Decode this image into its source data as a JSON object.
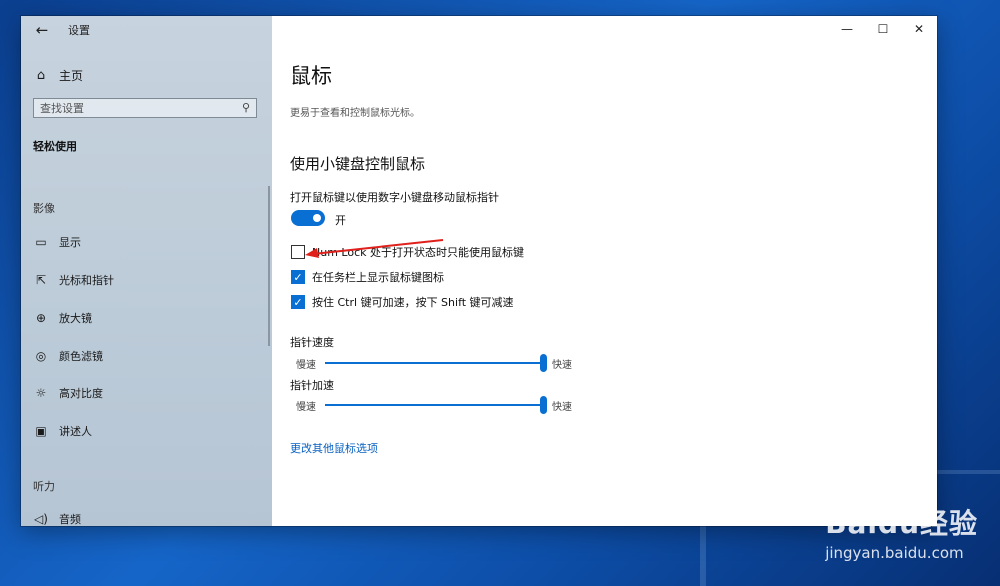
{
  "window": {
    "title": "设置",
    "controls": {
      "minimize": "—",
      "maximize": "☐",
      "close": "✕"
    }
  },
  "sidebar": {
    "back_glyph": "←",
    "home_label": "主页",
    "search_placeholder": "查找设置",
    "category": "轻松使用",
    "groups": [
      {
        "label": "影像",
        "items": [
          "显示",
          "光标和指针",
          "放大镜",
          "颜色滤镜",
          "高对比度",
          "讲述人"
        ]
      },
      {
        "label": "听力",
        "items": [
          "音频"
        ]
      }
    ]
  },
  "main": {
    "title": "鼠标",
    "description": "更易于查看和控制鼠标光标。",
    "section_heading": "使用小键盘控制鼠标",
    "toggle_label": "打开鼠标键以使用数字小键盘移动鼠标指针",
    "toggle_state": "开",
    "toggle_on": true,
    "checkboxes": [
      {
        "label": "Num Lock 处于打开状态时只能使用鼠标键",
        "checked": false
      },
      {
        "label": "在任务栏上显示鼠标键图标",
        "checked": true
      },
      {
        "label": "按住 Ctrl 键可加速，按下 Shift 键可减速",
        "checked": true
      }
    ],
    "sliders": [
      {
        "label": "指针速度",
        "min_label": "慢速",
        "max_label": "快速",
        "value_fraction": 1.0
      },
      {
        "label": "指针加速",
        "min_label": "慢速",
        "max_label": "快速",
        "value_fraction": 1.0
      }
    ],
    "link": "更改其他鼠标选项"
  },
  "watermark": {
    "logo": "Baidu经验",
    "url": "jingyan.baidu.com"
  },
  "colors": {
    "accent": "#0a6fd3",
    "sidebar_bg": "#c2d0dc",
    "annotation": "#e0201b"
  }
}
